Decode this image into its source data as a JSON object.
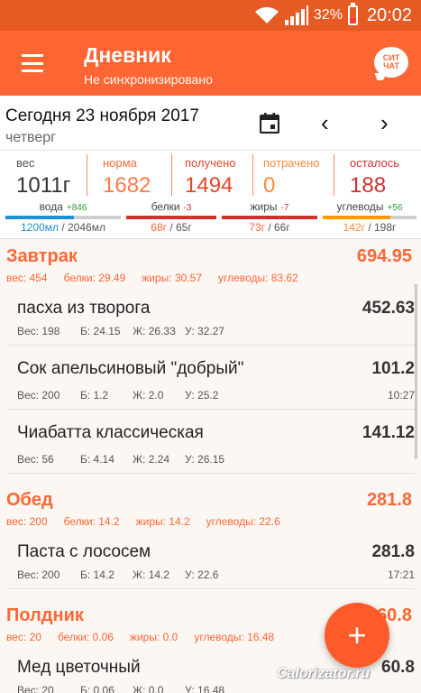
{
  "status": {
    "battery": "32%",
    "time": "20:02"
  },
  "appbar": {
    "title": "Дневник",
    "subtitle": "Не синхронизировано",
    "chat_line1": "СИТ",
    "chat_line2": "ЧАТ"
  },
  "date": {
    "main": "Сегодня 23 ноября 2017",
    "day": "четверг",
    "prev": "‹",
    "next": "›"
  },
  "stats": {
    "weight_label": "вес",
    "weight_value": "1011г",
    "norm_label": "норма",
    "norm_value": "1682",
    "got_label": "получено",
    "got_value": "1494",
    "spent_label": "потрачено",
    "spent_value": "0",
    "left_label": "осталось",
    "left_value": "188"
  },
  "macros": {
    "water": {
      "label": "вода",
      "delta": "+846",
      "value": "1200мл",
      "norm": " / 2046мл",
      "fraction": 0.59
    },
    "protein": {
      "label": "белки",
      "delta": "-3",
      "value": "68г",
      "norm": " / 65г",
      "fraction": 1.0
    },
    "fat": {
      "label": "жиры",
      "delta": "-7",
      "value": "73г",
      "norm": " / 66г",
      "fraction": 1.0
    },
    "carbs": {
      "label": "углеводы",
      "delta": "+56",
      "value": "142г",
      "norm": " / 198г",
      "fraction": 0.72
    }
  },
  "colors": {
    "accent": "#ff6634",
    "water": "#1e90d6",
    "protein": "#d32f2f",
    "fat": "#d32f2f",
    "carbs": "#ff9800",
    "green": "#2e9e3a"
  },
  "meals": {
    "breakfast": {
      "name": "Завтрак",
      "kcal": "694.95",
      "weight": "вес: 454",
      "protein": "белки: 29.49",
      "fat": "жиры: 30.57",
      "carbs": "углеводы: 83.62"
    },
    "lunch": {
      "name": "Обед",
      "kcal": "281.8",
      "weight": "вес: 200",
      "protein": "белки: 14.2",
      "fat": "жиры: 14.2",
      "carbs": "углеводы: 22.6"
    },
    "snack": {
      "name": "Полдник",
      "kcal": "60.8",
      "weight": "вес: 20",
      "protein": "белки: 0.06",
      "fat": "жиры: 0.0",
      "carbs": "углеводы: 16.48"
    }
  },
  "foods": [
    {
      "name": "пасха из творога",
      "kcal": "452.63",
      "weight": "Вес: 198",
      "p": "Б: 24.15",
      "f": "Ж: 26.33",
      "c": "У: 32.27",
      "time": ""
    },
    {
      "name": "Сок апельсиновый \"добрый\"",
      "kcal": "101.2",
      "weight": "Вес: 200",
      "p": "Б: 1.2",
      "f": "Ж: 2.0",
      "c": "У: 25.2",
      "time": "10:27"
    },
    {
      "name": "Чиабатта классическая",
      "kcal": "141.12",
      "weight": "Вес: 56",
      "p": "Б: 4.14",
      "f": "Ж: 2.24",
      "c": "У: 26.15",
      "time": ""
    },
    {
      "name": "Паста с лососем",
      "kcal": "281.8",
      "weight": "Вес: 200",
      "p": "Б: 14.2",
      "f": "Ж: 14.2",
      "c": "У: 22.6",
      "time": "17:21"
    },
    {
      "name": "Мед цветочный",
      "kcal": "60.8",
      "weight": "Вес: 20",
      "p": "Б: 0.06",
      "f": "Ж: 0.0",
      "c": "У: 16.48",
      "time": ""
    }
  ],
  "fab": {
    "label": "+"
  },
  "watermark": "Calorizator.ru"
}
